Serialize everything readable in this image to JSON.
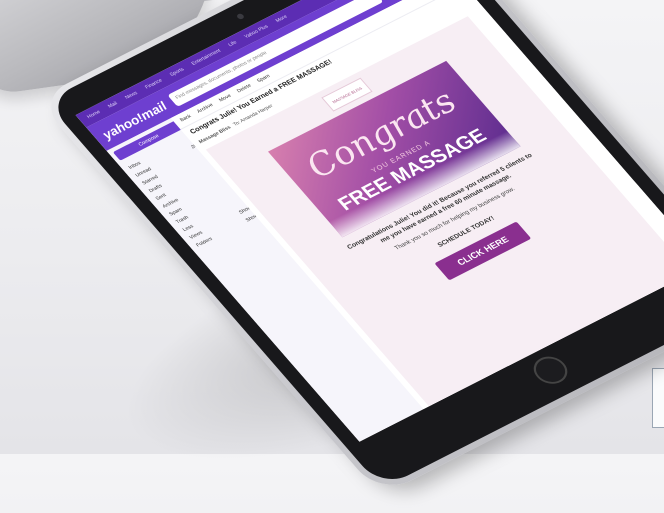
{
  "topbar": {
    "items": [
      "Home",
      "Mail",
      "News",
      "Finance",
      "Sports",
      "Entertainment",
      "Life",
      "Yahoo Plus",
      "More"
    ]
  },
  "mailbar": {
    "logo": "yahoo!mail",
    "search_placeholder": "Find messages, documents, photos or people"
  },
  "sidebar": {
    "compose": "Compose",
    "items": [
      {
        "label": "Inbox",
        "count": ""
      },
      {
        "label": "Unread",
        "count": "20"
      },
      {
        "label": "Starred",
        "count": ""
      },
      {
        "label": "Drafts",
        "count": ""
      },
      {
        "label": "Sent",
        "count": ""
      },
      {
        "label": "Archive",
        "count": ""
      },
      {
        "label": "Spam",
        "count": ""
      },
      {
        "label": "Trash",
        "count": ""
      },
      {
        "label": "Less",
        "count": ""
      },
      {
        "label": "Views",
        "count": "Show"
      },
      {
        "label": "Folders",
        "count": "Show"
      }
    ]
  },
  "toolbar": {
    "back": "Back",
    "archive": "Archive",
    "move": "Move",
    "delete": "Delete",
    "spam": "Spam"
  },
  "email": {
    "subject": "Congrats Julie! You Earned a FREE MASSAGE!",
    "sender": "Massage Bliss",
    "recipient": "To: Amanda Harper",
    "brand": "MASSAGE BLISS",
    "hero_title": "Congrats",
    "hero_earned": "YOU EARNED A",
    "hero_offer": "FREE MASSAGE",
    "message": "Congratulations Julie! You did it! Because you referred 5 clients to me you have earned a free 60 minute massage.",
    "thanks": "Thank you so much for helping my business grow.",
    "schedule": "SCHEDULE TODAY!",
    "cta": "CLICK HERE"
  },
  "colors": {
    "brand_purple": "#6e3fd0",
    "cta": "#8a2f8f"
  }
}
